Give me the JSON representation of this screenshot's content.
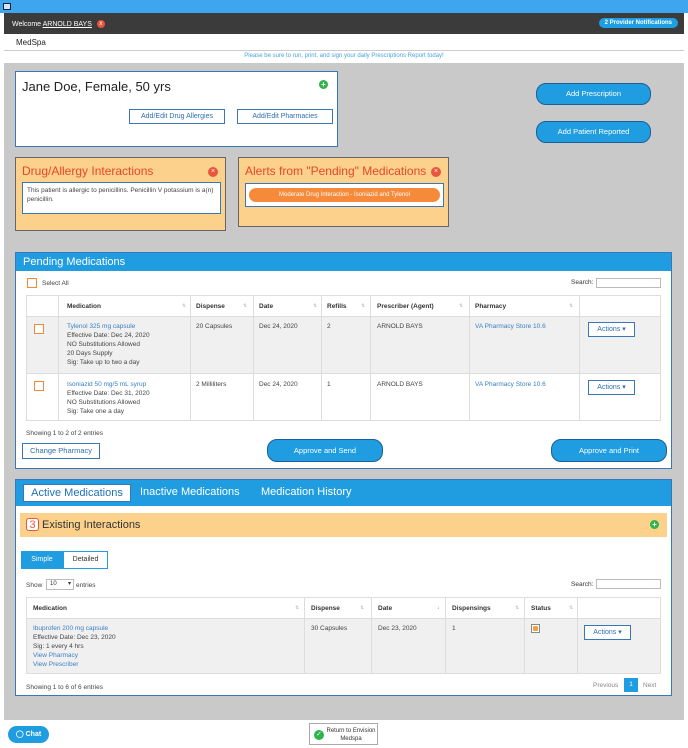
{
  "header": {
    "welcome_prefix": "Welcome",
    "user_name": "ARNOLD BAYS",
    "close_icon": "x",
    "notifications": "2 Provider Notifications"
  },
  "subheader": {
    "brand": "MedSpa"
  },
  "banner": {
    "text": "Please be sure to run, print, and sign your daily Prescriptions Report today!"
  },
  "patient": {
    "name_line": "Jane Doe, Female, 50 yrs",
    "add_icon": "+",
    "allergies_button": "Add/Edit Drug Allergies",
    "pharmacies_button": "Add/Edit Pharmacies"
  },
  "actions": {
    "add_prescription": "Add Prescription",
    "add_patient_reported": "Add Patient Reported"
  },
  "interactions_box": {
    "title": "Drug/Allergy Interactions",
    "text": "This patient is allergic to penicillins. Penicillin V potassium is a(n) penicillin."
  },
  "alerts_box": {
    "title": "Alerts from \"Pending\" Medications",
    "pill": "Moderate Drug Interaction - Isoniazid and Tylenol"
  },
  "pending": {
    "title": "Pending Medications",
    "select_all": "Select All",
    "search_label": "Search:",
    "columns": [
      "Medication",
      "Dispense",
      "Date",
      "Refills",
      "Prescriber (Agent)",
      "Pharmacy"
    ],
    "rows": [
      {
        "medication": "Tylenol 325 mg capsule",
        "details": [
          "Effective Date: Dec 24, 2020",
          "NO Substitutions Allowed",
          "20 Days Supply",
          "Sig: Take up to two a day"
        ],
        "dispense": "20 Capsules",
        "date": "Dec 24, 2020",
        "refills": "2",
        "prescriber": "ARNOLD BAYS",
        "pharmacy": "VA Pharmacy Store 10.6",
        "action": "Actions"
      },
      {
        "medication": "Isoniazid 50 mg/5 mL syrup",
        "details": [
          "Effective Date: Dec 31, 2020",
          "NO Substitutions Allowed",
          "Sig: Take one a day"
        ],
        "dispense": "2 Milliliters",
        "date": "Dec 24, 2020",
        "refills": "1",
        "prescriber": "ARNOLD BAYS",
        "pharmacy": "VA Pharmacy Store 10.6",
        "action": "Actions"
      }
    ],
    "showing": "Showing 1 to 2 of 2 entries",
    "change_pharmacy": "Change Pharmacy",
    "approve_send": "Approve and Send",
    "approve_print": "Approve and Print"
  },
  "active": {
    "tabs": [
      "Active Medications",
      "Inactive Medications",
      "Medication History"
    ],
    "existing_count": "3",
    "existing_title": "Existing Interactions",
    "toggle_simple": "Simple",
    "toggle_detailed": "Detailed",
    "show_label": "Show",
    "show_value": "10",
    "entries_label": "entries",
    "search_label": "Search:",
    "columns": [
      "Medication",
      "Dispense",
      "Date",
      "Dispensings",
      "Status"
    ],
    "rows": [
      {
        "medication": "Ibuprofen 200 mg capsule",
        "details": [
          "Effective Date: Dec 23, 2020",
          "Sig: 1 every 4 hrs"
        ],
        "links": [
          "View Pharmacy",
          "View Prescriber"
        ],
        "dispense": "30 Capsules",
        "date": "Dec 23, 2020",
        "dispensings": "1",
        "action": "Actions"
      }
    ],
    "showing": "Showing 1 to 6 of 6 entries",
    "prev": "Previous",
    "page": "1",
    "next": "Next"
  },
  "footer": {
    "chat": "Chat",
    "return_line1": "Return to Envision",
    "return_line2": "Medspa"
  },
  "colors": {
    "accent": "#1f9de0",
    "warning": "#fcd18c",
    "danger": "#e8553c"
  }
}
